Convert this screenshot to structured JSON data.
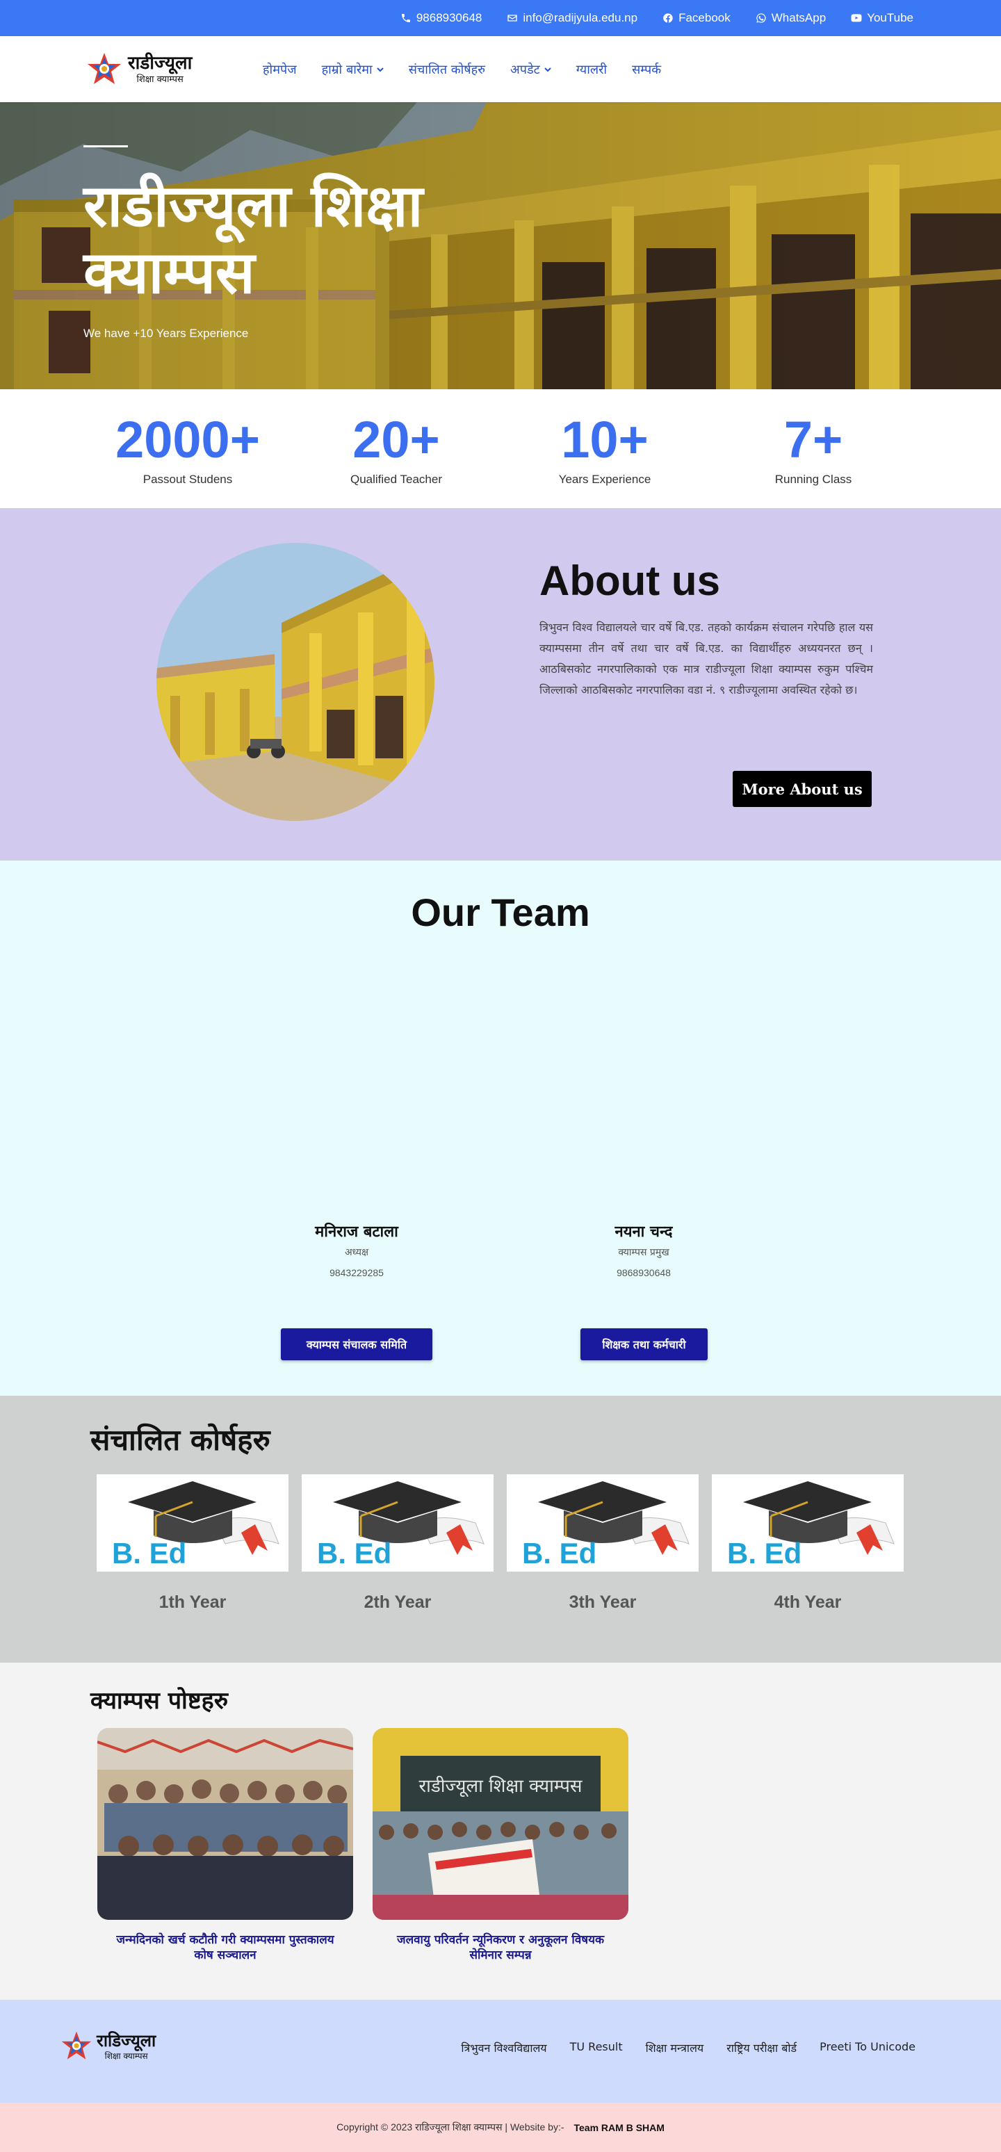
{
  "topbar": {
    "phone": "9868930648",
    "email": "info@radijyula.edu.np",
    "facebook": "Facebook",
    "whatsapp": "WhatsApp",
    "youtube": "YouTube"
  },
  "logo": {
    "line1": "राडीज्यूला",
    "line2": "शिक्षा क्याम्पस"
  },
  "nav": {
    "items": [
      {
        "label": "होमपेज",
        "dropdown": false
      },
      {
        "label": "हाम्रो बारेमा",
        "dropdown": true
      },
      {
        "label": "संचालित कोर्षहरु",
        "dropdown": false
      },
      {
        "label": "अपडेट",
        "dropdown": true
      },
      {
        "label": "ग्यालरी",
        "dropdown": false
      },
      {
        "label": "सम्पर्क",
        "dropdown": false
      }
    ]
  },
  "hero": {
    "title": "राडीज्यूला शिक्षा क्याम्पस",
    "subtitle": "We have +10 Years Experience"
  },
  "stats": [
    {
      "value": "2000+",
      "label": "Passout Studens"
    },
    {
      "value": "20+",
      "label": "Qualified Teacher"
    },
    {
      "value": "10+",
      "label": "Years Experience"
    },
    {
      "value": "7+",
      "label": "Running Class"
    }
  ],
  "about": {
    "heading": "About us",
    "text": "त्रिभुवन विश्व विद्यालयले चार वर्षे बि.एड. तहको कार्यक्रम संचालन गरेपछि हाल यस क्याम्पसमा तीन वर्षे तथा चार वर्षे बि.एड. का विद्यार्थीहरु अध्ययनरत छन् । आठबिसकोट नगरपालिकाको एक मात्र राडीज्यूला शिक्षा क्याम्पस रुकुम पश्चिम जिल्लाको आठबिसकोट नगरपालिका वडा नं. ९ राडीज्यूलामा अवस्थित रहेको छ।",
    "button": "More About us"
  },
  "team": {
    "heading": "Our Team",
    "members": [
      {
        "name": "मनिराज बटाला",
        "role": "अध्यक्ष",
        "phone": "9843229285"
      },
      {
        "name": "नयना चन्द",
        "role": "क्याम्पस प्रमुख",
        "phone": "9868930648"
      }
    ],
    "buttons": [
      "क्याम्पस संचालक समिति",
      "शिक्षक तथा कर्मचारी"
    ]
  },
  "courses": {
    "heading": "संचालित कोर्षहरु",
    "badge": "B. Ed",
    "items": [
      "1th Year",
      "2th Year",
      "3th Year",
      "4th Year"
    ]
  },
  "posts": {
    "heading": "क्याम्पस पोष्टहरु",
    "items": [
      {
        "title": "जन्मदिनको खर्च कटौती गरी क्याम्पसमा पुस्तकालय कोष सञ्चालन"
      },
      {
        "title": "जलवायु परिवर्तन न्यूनिकरण र अनुकूलन विषयक सेमिनार सम्पन्न"
      }
    ],
    "sign_text": "राडीज्यूला शिक्षा क्याम्पस"
  },
  "footer": {
    "logo_line1": "राडिज्यूला",
    "logo_line2": "शिक्षा क्याम्पस",
    "links": [
      "त्रिभुवन विश्वविद्यालय",
      "TU Result",
      "शिक्षा मन्त्रालय",
      "राष्ट्रिय परीक्षा बोर्ड",
      "Preeti To Unicode"
    ]
  },
  "copyright": {
    "text": "Copyright © 2023 राडिज्यूला शिक्षा क्याम्पस | Website by:-",
    "team": "Team RAM B SHAM"
  },
  "colors": {
    "topbar": "#3b78f5",
    "accent_blue": "#3b6ff0",
    "about_bg": "#d2c9ef",
    "team_bg": "#e8fbfd",
    "courses_bg": "#cfd1d0",
    "posts_bg": "#f3f3f3",
    "footer_bg": "#cedbfd",
    "copyright_bg": "#fdd8d8",
    "dark_blue_button": "#1a1a9e"
  }
}
